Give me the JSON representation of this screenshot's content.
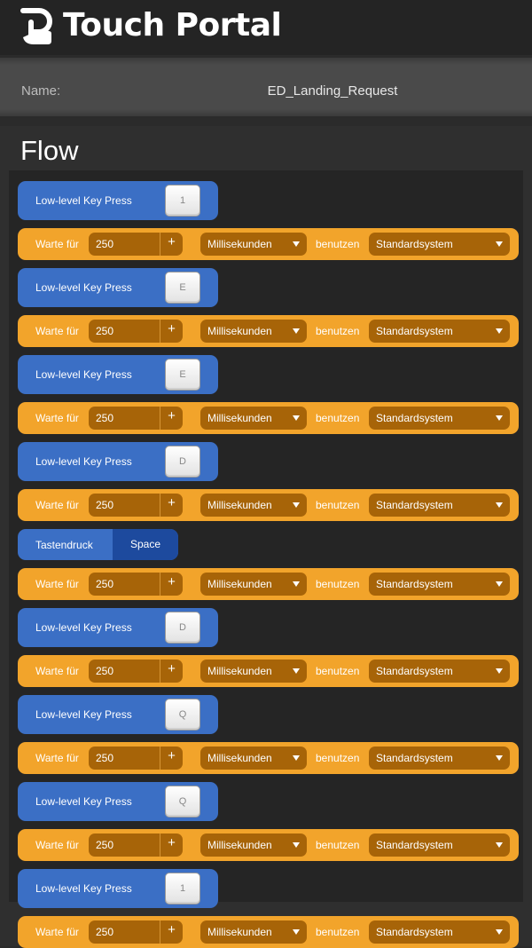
{
  "header": {
    "title": "Touch Portal",
    "logo": "touch-portal-logo-icon"
  },
  "name_bar": {
    "label": "Name:",
    "value": "ED_Landing_Request"
  },
  "flow": {
    "title": "Flow",
    "wait_label": "Warte für",
    "wait_value": "250",
    "wait_unit": "Millisekunden",
    "uses_label": "benutzen",
    "system_value": "Standardsystem",
    "key_label": "Low-level Key Press",
    "tap_label": "Tastendruck",
    "colors": {
      "key": "#3b6fc5",
      "wait": "#f2a42b",
      "wait_field": "#a76408",
      "tap_key": "#1d4a9e"
    }
  },
  "steps": [
    {
      "type": "key",
      "key": "1"
    },
    {
      "type": "wait"
    },
    {
      "type": "key",
      "key": "E"
    },
    {
      "type": "wait"
    },
    {
      "type": "key",
      "key": "E"
    },
    {
      "type": "wait"
    },
    {
      "type": "key",
      "key": "D"
    },
    {
      "type": "wait"
    },
    {
      "type": "tap",
      "key": "Space"
    },
    {
      "type": "wait"
    },
    {
      "type": "key",
      "key": "D"
    },
    {
      "type": "wait"
    },
    {
      "type": "key",
      "key": "Q"
    },
    {
      "type": "wait"
    },
    {
      "type": "key",
      "key": "Q"
    },
    {
      "type": "wait"
    },
    {
      "type": "key",
      "key": "1"
    },
    {
      "type": "wait"
    }
  ]
}
